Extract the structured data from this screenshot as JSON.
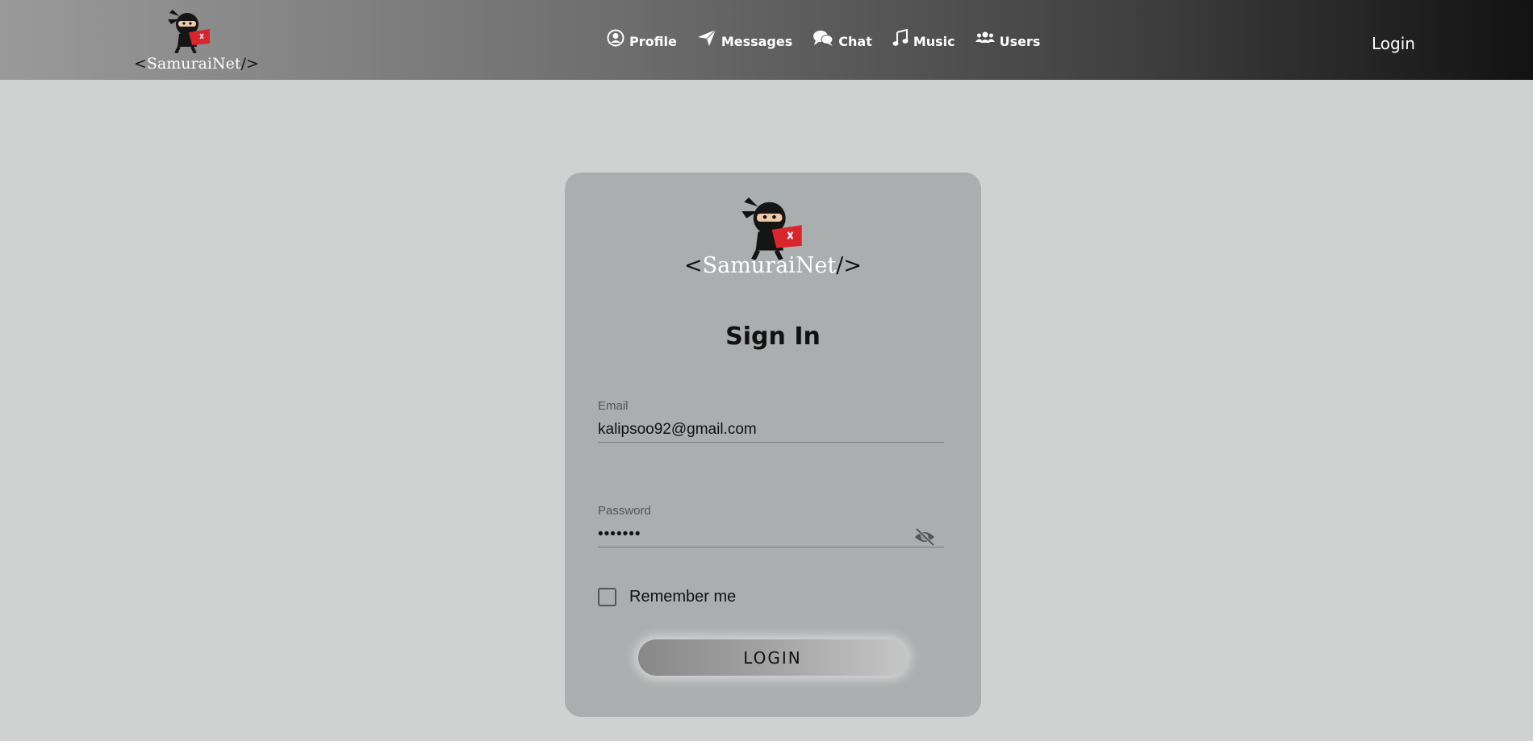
{
  "header": {
    "brand": {
      "prefix": "<",
      "core": "SamuraiNet",
      "suffix": "/>"
    },
    "nav": [
      {
        "label": "Profile",
        "icon": "user-circle-icon"
      },
      {
        "label": "Messages",
        "icon": "paper-plane-icon"
      },
      {
        "label": "Chat",
        "icon": "chat-bubbles-icon"
      },
      {
        "label": "Music",
        "icon": "music-note-icon"
      },
      {
        "label": "Users",
        "icon": "users-group-icon"
      }
    ],
    "login_label": "Login"
  },
  "card": {
    "brand": {
      "prefix": "<",
      "core": "SamuraiNet",
      "suffix": "/>"
    },
    "title": "Sign In",
    "email": {
      "label": "Email",
      "value": "kalipsoo92@gmail.com"
    },
    "password": {
      "label": "Password",
      "value": "•••••••",
      "toggle_icon": "eye-slash-icon"
    },
    "remember_label": "Remember me",
    "remember_checked": false,
    "login_button": "LOGIN"
  },
  "colors": {
    "page_bg": "#d0d2d1",
    "card_bg": "#abaeae",
    "ninja_red": "#d9262c"
  }
}
